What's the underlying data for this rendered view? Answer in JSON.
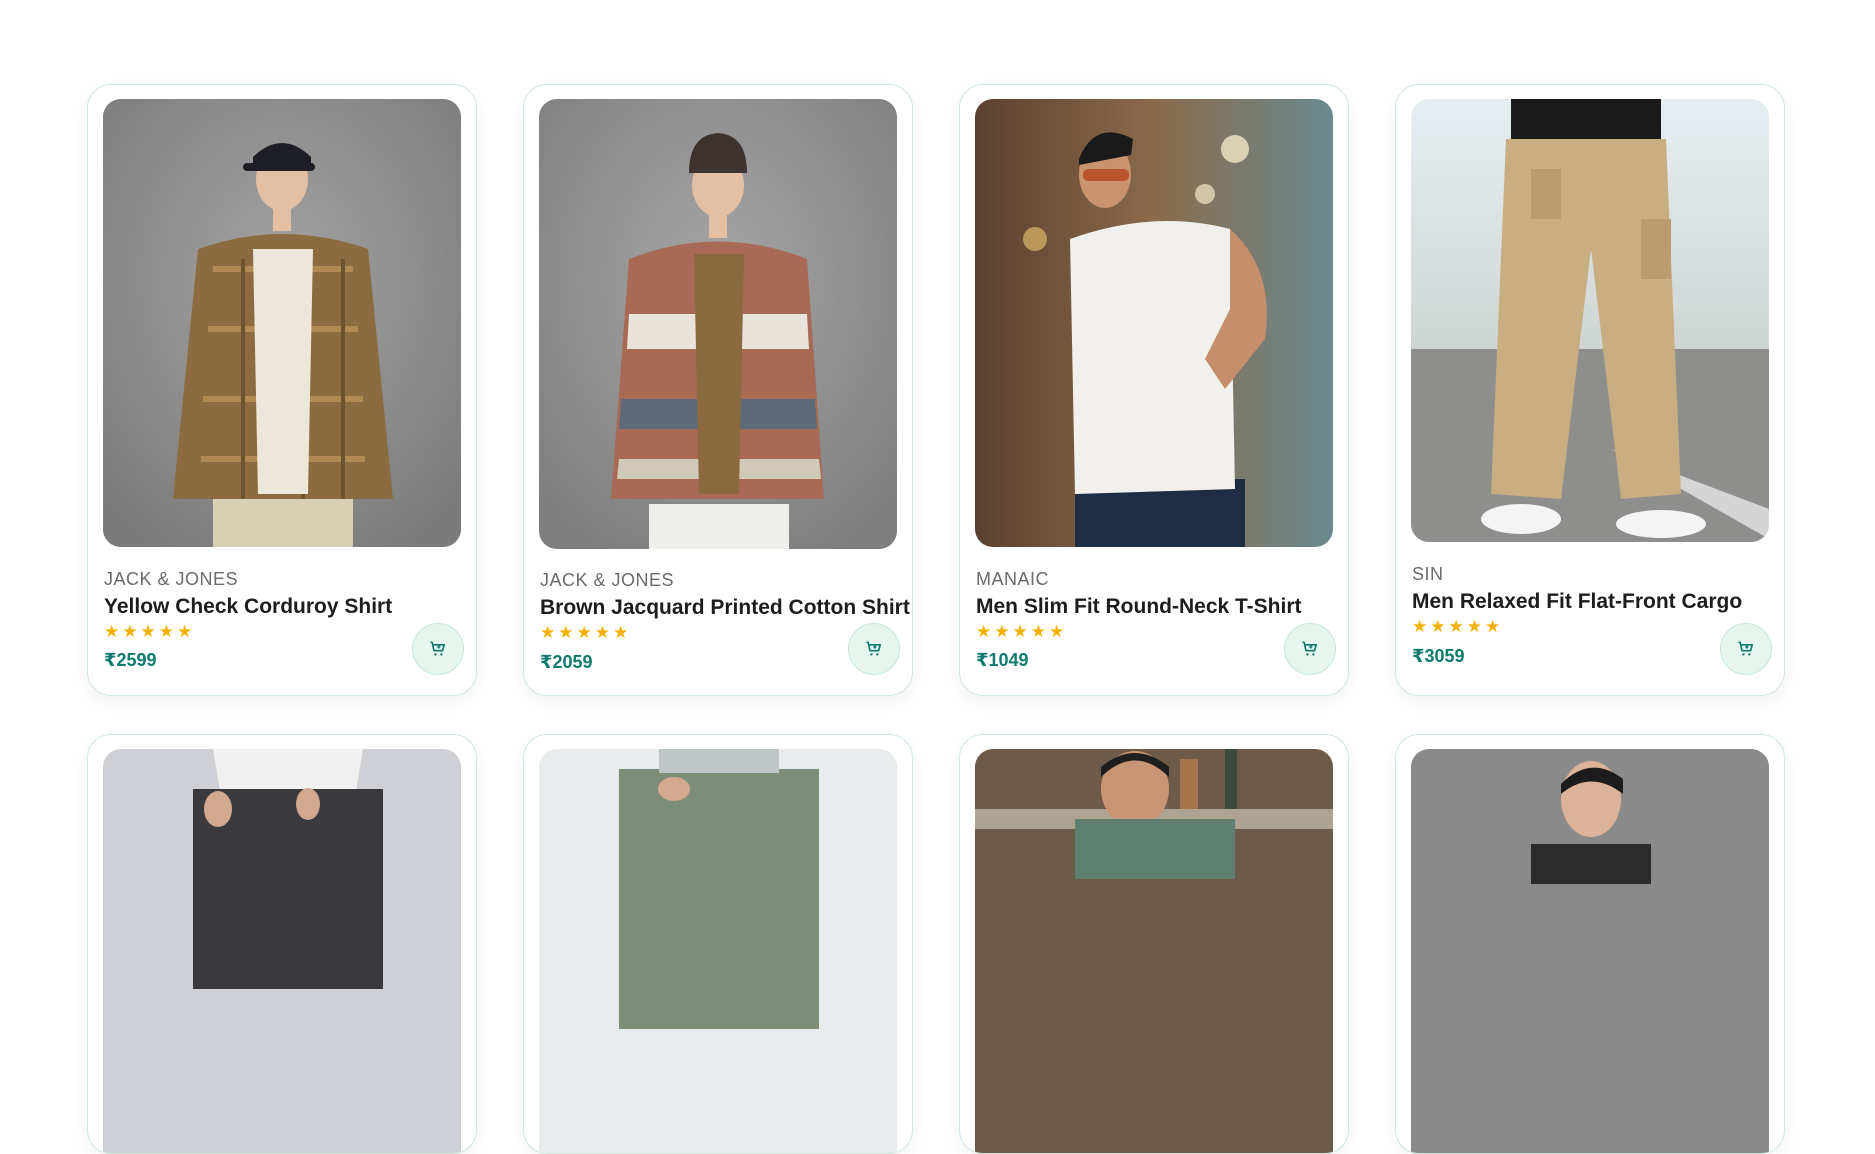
{
  "products": [
    {
      "brand": "JACK & JONES",
      "title": "Yellow Check Corduroy Shirt",
      "rating": 5,
      "stars": "★★★★★",
      "price": "₹2599",
      "image": "man-plaid-shirt-cap"
    },
    {
      "brand": "JACK & JONES",
      "title": "Brown Jacquard Printed Cotton Shirt",
      "rating": 5,
      "stars": "★★★★★",
      "price": "₹2059",
      "image": "man-aztec-print-shirt-beanie"
    },
    {
      "brand": "MANAIC",
      "title": "Men Slim Fit Round-Neck T-Shirt",
      "rating": 5,
      "stars": "★★★★★",
      "price": "₹1049",
      "image": "man-white-sleeveless-tee-sunglasses"
    },
    {
      "brand": "SIN",
      "title": "Men Relaxed Fit Flat-Front Cargo",
      "rating": 5,
      "stars": "★★★★★",
      "price": "₹3059",
      "image": "beige-cargo-pants-street"
    }
  ],
  "second_row": [
    {
      "image": "man-dark-jeans-white-shirt"
    },
    {
      "image": "light-wash-jeans"
    },
    {
      "image": "man-green-shirt-bar"
    },
    {
      "image": "man-dark-hair-grey-backdrop"
    }
  ],
  "colors": {
    "accent": "#0f7a6e",
    "star": "#f4b000",
    "cart_bg": "#e6f6ee",
    "card_border": "#cfe7df"
  },
  "icons": {
    "cart": "cart-icon",
    "star": "star-icon"
  }
}
